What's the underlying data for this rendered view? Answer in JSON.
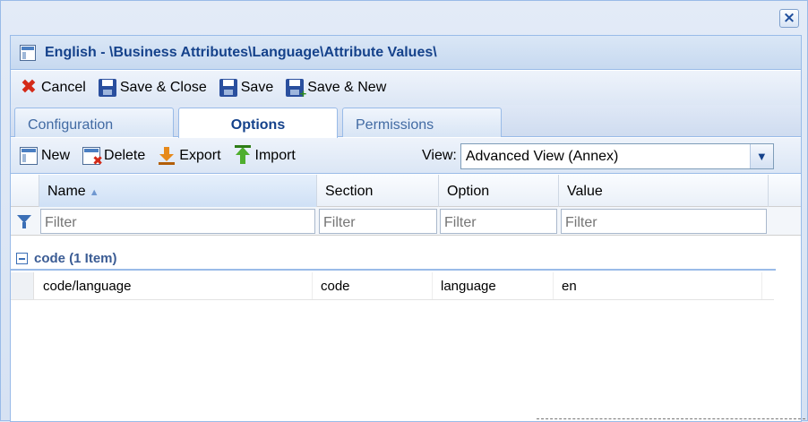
{
  "dialog": {
    "title": "English - \\Business Attributes\\Language\\Attribute Values\\"
  },
  "toolbar": {
    "cancel": "Cancel",
    "save_close": "Save & Close",
    "save": "Save",
    "save_new": "Save & New"
  },
  "tabs": [
    {
      "label": "Configuration",
      "active": false
    },
    {
      "label": "Options",
      "active": true
    },
    {
      "label": "Permissions",
      "active": false
    }
  ],
  "grid_toolbar": {
    "new": "New",
    "delete": "Delete",
    "export": "Export",
    "import": "Import",
    "view_label": "View:",
    "view_value": "Advanced View (Annex)"
  },
  "grid": {
    "columns": [
      {
        "label": "Name",
        "sorted": "asc"
      },
      {
        "label": "Section"
      },
      {
        "label": "Option"
      },
      {
        "label": "Value"
      }
    ],
    "filter_placeholder": "Filter",
    "group": {
      "label": "code (1 Item)"
    },
    "rows": [
      {
        "name": "code/language",
        "section": "code",
        "option": "language",
        "value": "en"
      }
    ]
  }
}
